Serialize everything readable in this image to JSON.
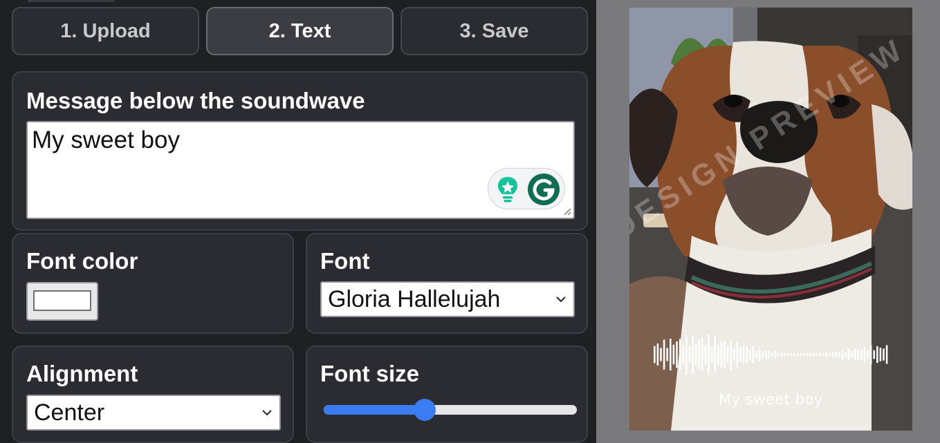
{
  "tabs": [
    {
      "label": "1. Upload",
      "active": false
    },
    {
      "label": "2. Text",
      "active": true
    },
    {
      "label": "3. Save",
      "active": false
    }
  ],
  "message": {
    "title": "Message below the soundwave",
    "value": "My sweet boy"
  },
  "font_color": {
    "title": "Font color",
    "value": "#ffffff"
  },
  "font": {
    "title": "Font",
    "selected": "Gloria Hallelujah"
  },
  "alignment": {
    "title": "Alignment",
    "selected": "Center"
  },
  "font_size": {
    "title": "Font size",
    "level": 0.4
  },
  "preview": {
    "watermark": "DESIGN PREVIEW",
    "caption": "My sweet boy"
  },
  "colors": {
    "accent": "#3b7cf4",
    "grammarly_green": "#15c39a",
    "grammarly_dark": "#0f6e52"
  },
  "icons": [
    "grammarly-suggestion-icon",
    "grammarly-logo-icon",
    "resize-grip-icon",
    "chevron-down-icon"
  ]
}
